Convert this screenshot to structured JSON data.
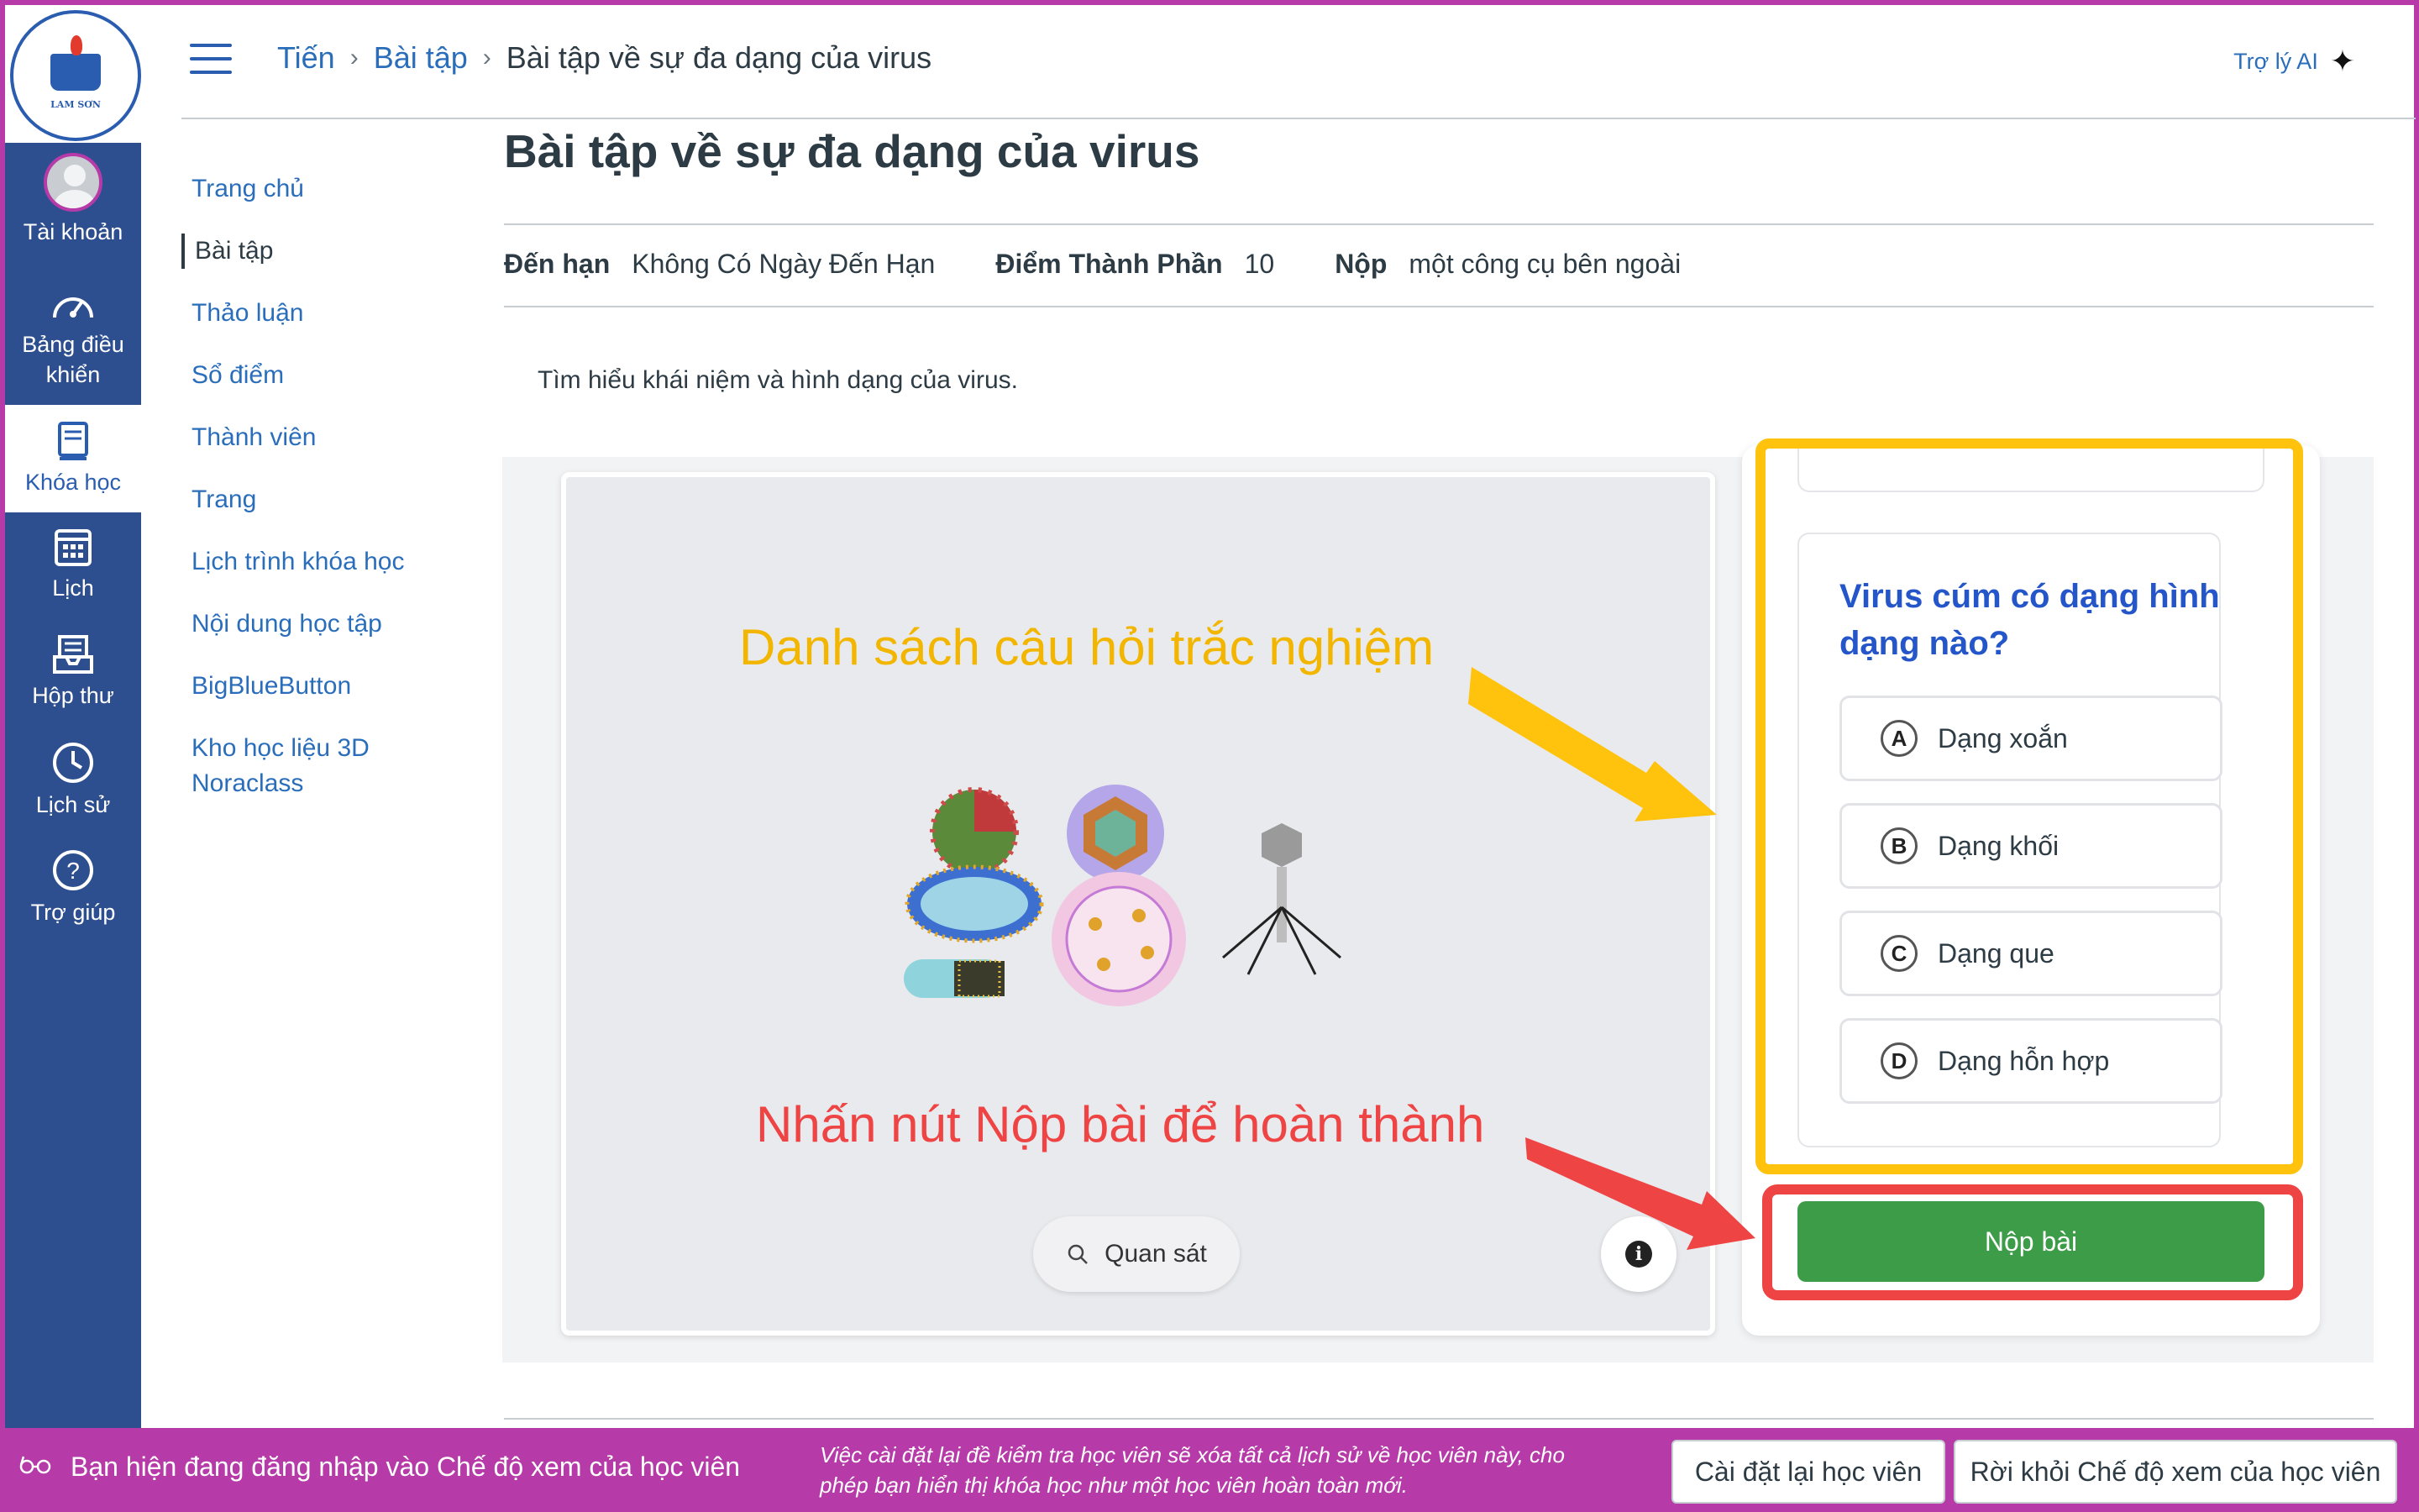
{
  "global_nav": {
    "logo_text": "LAM SƠN",
    "items": [
      {
        "label": "Tài khoản"
      },
      {
        "label": "Bảng điều khiển"
      },
      {
        "label": "Khóa học"
      },
      {
        "label": "Lịch"
      },
      {
        "label": "Hộp thư"
      },
      {
        "label": "Lịch sử"
      },
      {
        "label": "Trợ giúp"
      }
    ]
  },
  "header": {
    "breadcrumb": [
      "Tiến",
      "Bài tập",
      "Bài tập về sự đa dạng của virus"
    ],
    "ai_label": "Trợ lý AI"
  },
  "course_nav": {
    "items": [
      "Trang chủ",
      "Bài tập",
      "Thảo luận",
      "Sổ điểm",
      "Thành viên",
      "Trang",
      "Lịch trình khóa học",
      "Nội dung học tập",
      "BigBlueButton",
      "Kho học liệu 3D Noraclass"
    ]
  },
  "assignment": {
    "title": "Bài tập về sự đa dạng của virus",
    "due_label": "Đến hạn",
    "due_value": "Không Có Ngày Đến Hạn",
    "points_label": "Điểm Thành Phần",
    "points_value": "10",
    "submit_label": "Nộp",
    "submit_value": "một công cụ bên ngoài",
    "description": "Tìm hiểu khái niệm và hình dạng của virus."
  },
  "tool": {
    "annotation_questions": "Danh sách câu hỏi trắc nghiệm",
    "annotation_submit": "Nhấn nút Nộp bài để hoàn thành",
    "observe_label": "Quan sát",
    "question": "Virus cúm có dạng hình dạng nào?",
    "options": [
      {
        "letter": "A",
        "text": "Dạng xoắn"
      },
      {
        "letter": "B",
        "text": "Dạng khối"
      },
      {
        "letter": "C",
        "text": "Dạng que"
      },
      {
        "letter": "D",
        "text": "Dạng hỗn hợp"
      }
    ],
    "submit_button": "Nộp bài"
  },
  "banner": {
    "message": "Bạn hiện đang đăng nhập vào Chế độ xem của học viên",
    "note": "Việc cài đặt lại đề kiểm tra học viên sẽ xóa tất cả lịch sử về học viên này, cho phép bạn hiển thị khóa học như một học viên hoàn toàn mới.",
    "reset_button": "Cài đặt lại học viên",
    "leave_button": "Rời khỏi Chế độ xem của học viên"
  },
  "colors": {
    "nav_blue": "#2e4f8f",
    "link_blue": "#2a6ebb",
    "banner_purple": "#b63aa8",
    "submit_green": "#3d9c48",
    "annotation_yellow": "#ffc20d",
    "annotation_red": "#ef4444"
  }
}
